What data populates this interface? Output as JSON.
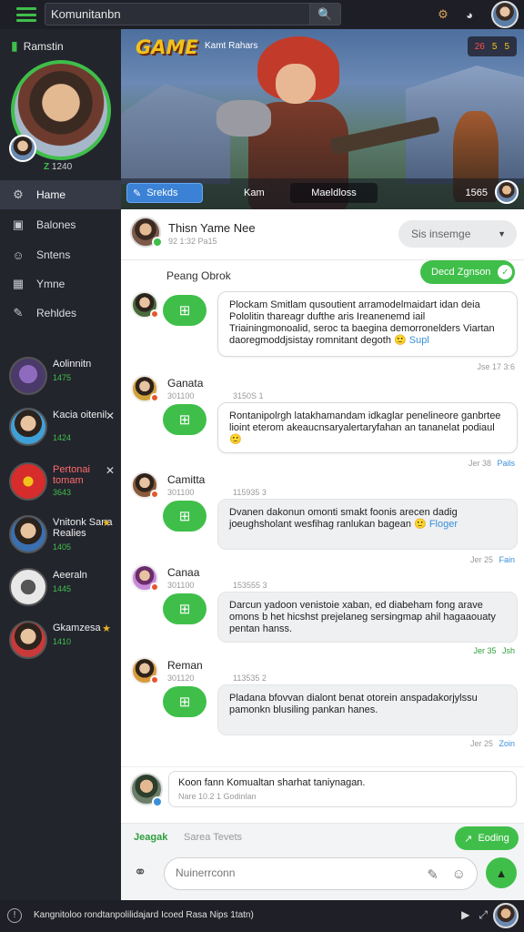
{
  "topbar": {
    "search_value": "Komunitanbn",
    "search_icon": "search-icon",
    "icons": [
      "robot-icon",
      "user-circle-icon"
    ]
  },
  "sidebar": {
    "username": "Ramstin",
    "level": "1240",
    "level_prefix": "Z",
    "nav": [
      {
        "label": "Hame",
        "icon": "gear-icon"
      },
      {
        "label": "Balones",
        "icon": "box-icon"
      },
      {
        "label": "Sntens",
        "icon": "people-icon"
      },
      {
        "label": "Ymne",
        "icon": "grid-icon"
      },
      {
        "label": "Rehldes",
        "icon": "wrench-icon"
      }
    ],
    "friends": [
      {
        "name": "Aolinnitn",
        "status": "1475"
      },
      {
        "name": "Kacia oitenil",
        "status": "1424"
      },
      {
        "name": "Pertonai tomam",
        "status": "3643"
      },
      {
        "name": "Vnitonk Sana Realies",
        "status": "1405"
      },
      {
        "name": "Aeeraln",
        "status": "1445"
      },
      {
        "name": "Gkamzesa",
        "status": "1410"
      }
    ]
  },
  "banner": {
    "logo": "GAME",
    "subtitle": "Kamt Rahars",
    "hud": [
      "26",
      "5",
      "5"
    ],
    "button": "Srekds",
    "item1": "Kam",
    "pill": "Maeldloss",
    "num": "1565"
  },
  "chat": {
    "title": "Thisn Yame Nee",
    "subtitle": "92 1:32 Pa15",
    "select": "Sis insemge",
    "section_label": "Peang Obrok",
    "section_button": "Decd Zgnson",
    "messages": [
      {
        "name": "",
        "meta": "",
        "meta2": "",
        "text": "Plockam Smitlam qusoutient arramodelmaidart idan deia Pololitin thareagr dufthe aris Ireanenemd iail Triainingmonoalid, seroc ta baegina demorronelders Viartan daoregmoddjsistay romnitant degoth",
        "tail": "Supl",
        "time": "Jse 17  3:6",
        "time_link": "",
        "style": "white",
        "green": false
      },
      {
        "name": "Ganata",
        "meta": "301100",
        "meta2": "3150S  1",
        "text": "Rontanipolrgh latakhamandam idkaglar penelineore ganbrtee lioint eterom akeaucnsaryalertaryfahan an tananelat podiaul",
        "tail": "",
        "time": "Jer 38",
        "time_link": "Pails",
        "style": "white",
        "green": false
      },
      {
        "name": "Camitta",
        "meta": "301100",
        "meta2": "115935  3",
        "text": "Dvanen dakonun omonti smakt foonis arecen dadig joeughsholant wesfihag ranlukan bagean",
        "tail": "Floger",
        "time": "Jer 25",
        "time_link": "Fain",
        "style": "gray",
        "green": false
      },
      {
        "name": "Canaa",
        "meta": "301100",
        "meta2": "153555  3",
        "text": "Darcun yadoon venistoie xaban, ed diabeham fong arave omons b het hicshst prejelaneg sersingmap ahil hagaaouaty pentan hanss.",
        "tail": "",
        "time": "Jer 35",
        "time_link": "Jsh",
        "style": "gray",
        "green": true
      },
      {
        "name": "Reman",
        "meta": "301120",
        "meta2": "113535  2",
        "text": "Pladana bfovvan dialont benat otorein anspadakorjylssu pamonkn blusiling pankan hanes.",
        "tail": "",
        "time": "Jer 25",
        "time_link": "Zoin",
        "style": "gray",
        "green": false
      }
    ],
    "compose_text": "Koon fann Komualtan sharhat taniynagan.",
    "compose_sub": "Nare 10.2 1 Godinlan"
  },
  "footbar": {
    "tab_active": "Jeagak",
    "tab_other": "Sarea Tevets",
    "button": "Eoding"
  },
  "inputbar": {
    "placeholder": "Nuinerrconn"
  },
  "statusbar": {
    "text": "Kangnitoloo rondtanpolilidajard Icoed Rasa Nips  1tatn)"
  },
  "colors": {
    "accent": "#3fbf4a",
    "dark": "#23252d",
    "link": "#3a8fd8"
  }
}
